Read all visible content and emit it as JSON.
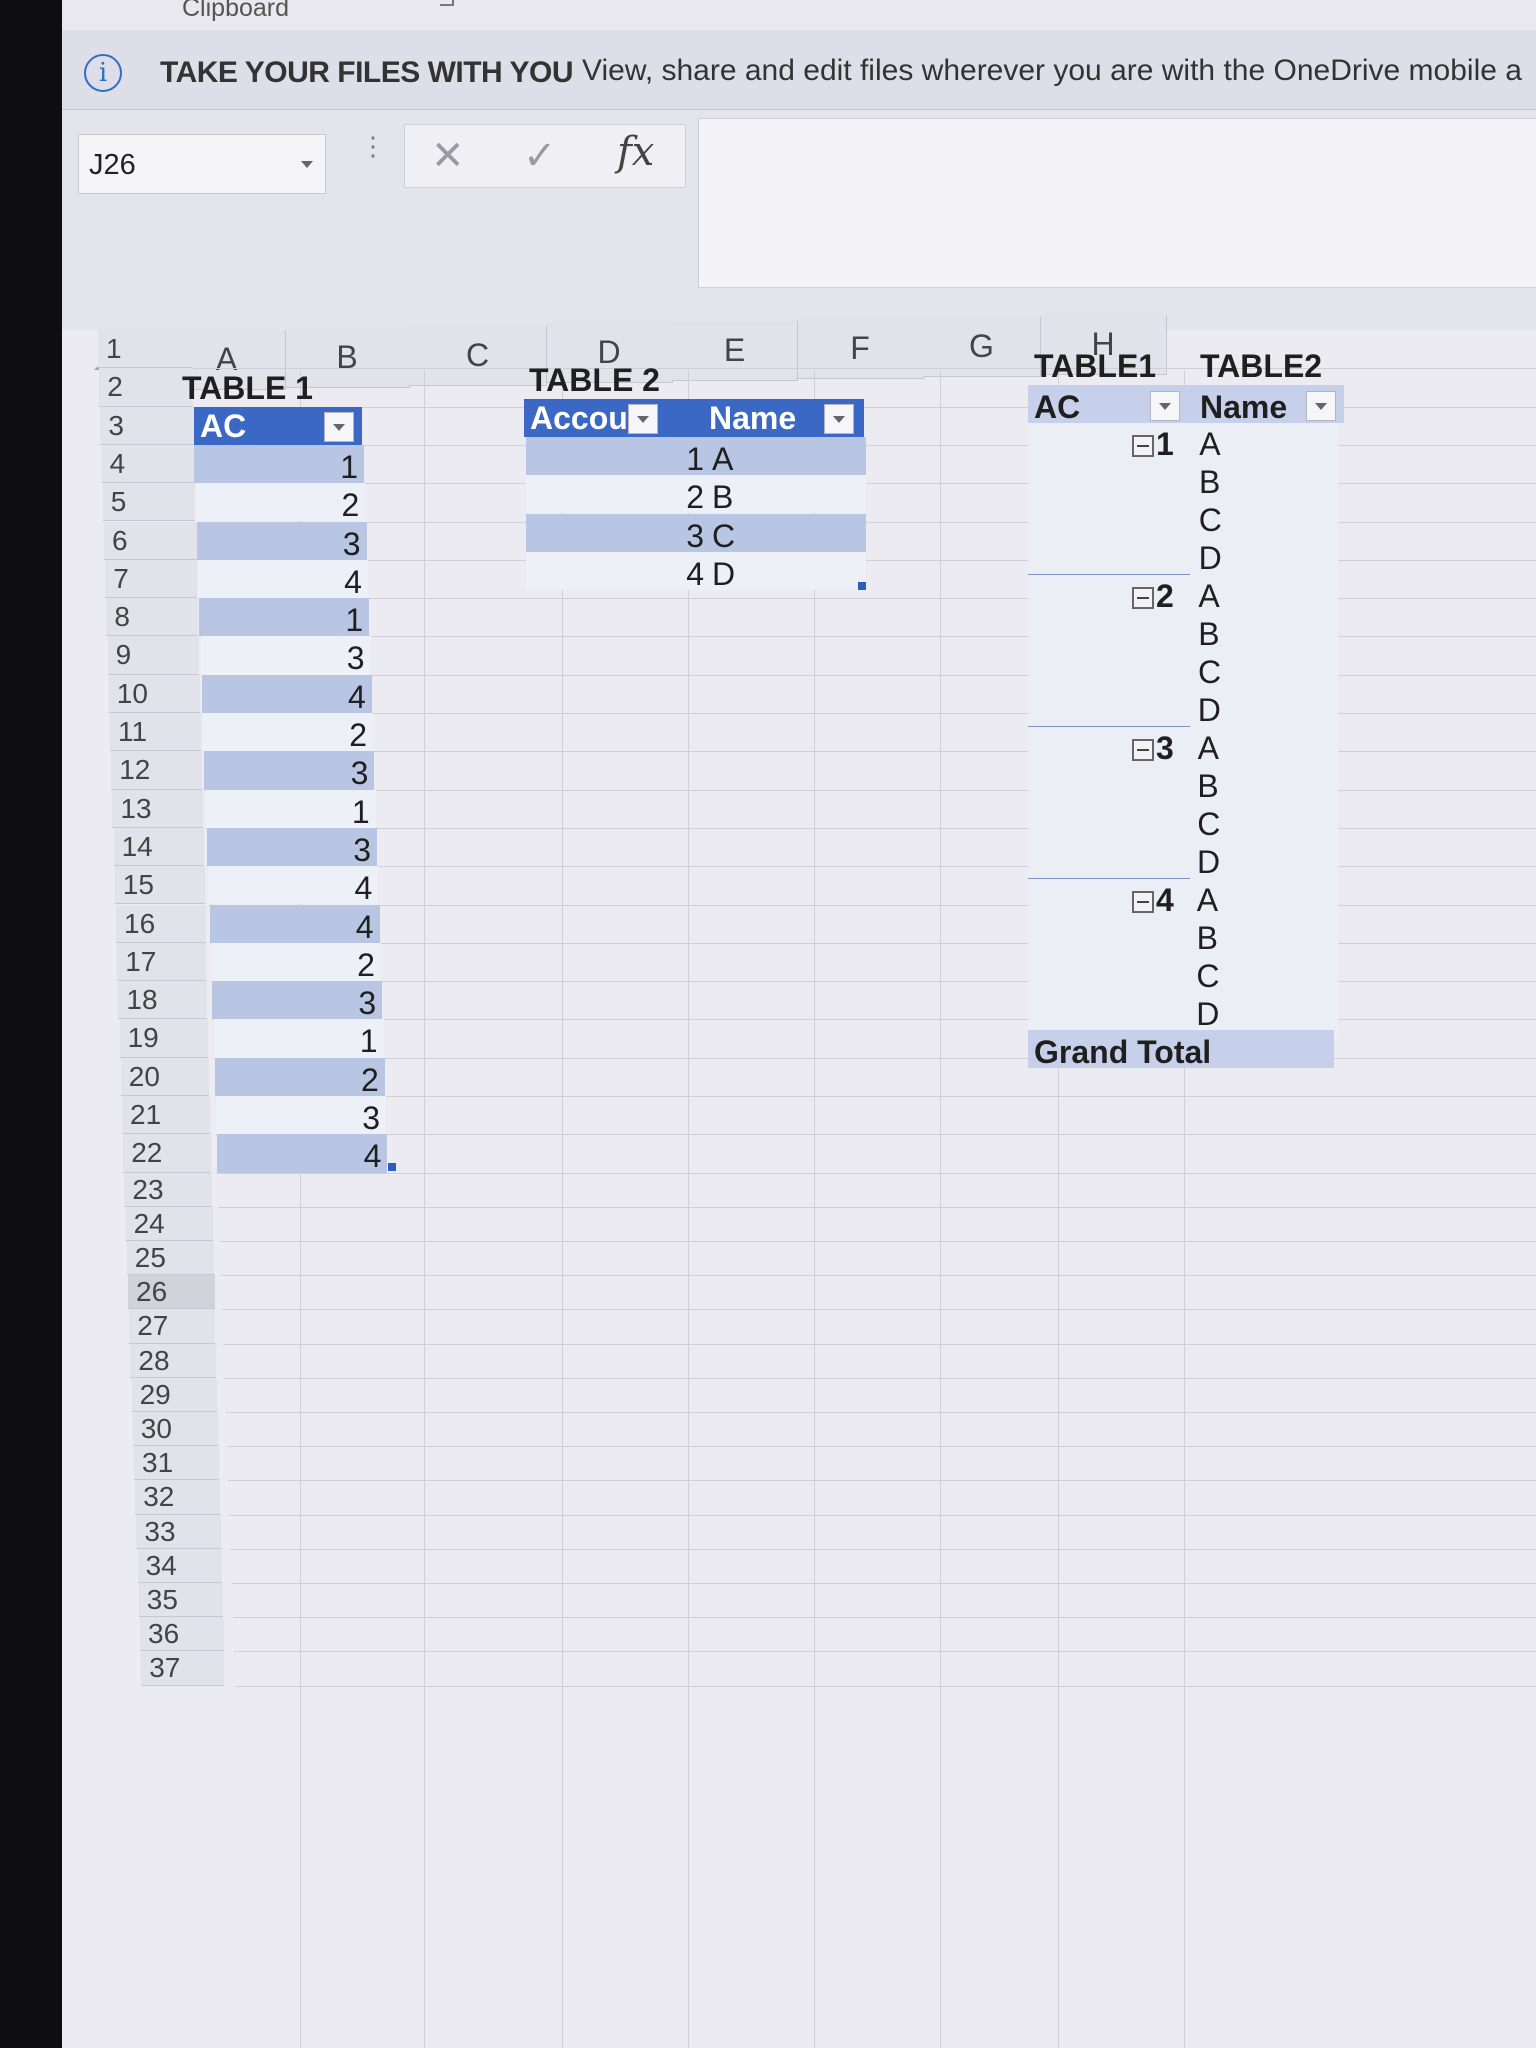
{
  "ribbon": {
    "group_label": "Clipboard"
  },
  "info_bar": {
    "title": "TAKE YOUR FILES WITH YOU",
    "message": "View, share and edit files wherever you are with the OneDrive mobile a"
  },
  "formula_bar": {
    "name_box": "J26",
    "cancel_glyph": "✕",
    "enter_glyph": "✓",
    "fx_label": "fx",
    "formula": ""
  },
  "columns": [
    "A",
    "B",
    "C",
    "D",
    "E",
    "F",
    "G",
    "H"
  ],
  "rows": [
    "1",
    "2",
    "3",
    "4",
    "5",
    "6",
    "7",
    "8",
    "9",
    "10",
    "11",
    "12",
    "13",
    "14",
    "15",
    "16",
    "17",
    "18",
    "19",
    "20",
    "21",
    "22",
    "23",
    "24",
    "25",
    "26",
    "27",
    "28",
    "29",
    "30",
    "31",
    "32",
    "33",
    "34",
    "35",
    "36",
    "37"
  ],
  "active_row": "26",
  "table1": {
    "title": "TABLE 1",
    "header": "AC",
    "values": [
      "1",
      "2",
      "3",
      "4",
      "1",
      "3",
      "4",
      "2",
      "3",
      "1",
      "3",
      "4",
      "4",
      "2",
      "3",
      "1",
      "2",
      "3",
      "4"
    ]
  },
  "table2": {
    "title": "TABLE 2",
    "headers": [
      "Account",
      "Name"
    ],
    "rows": [
      {
        "account": "1",
        "name": "A"
      },
      {
        "account": "2",
        "name": "B"
      },
      {
        "account": "3",
        "name": "C"
      },
      {
        "account": "4",
        "name": "D"
      }
    ]
  },
  "pivot": {
    "title_f": "TABLE1",
    "title_g": "TABLE2",
    "header_f": "AC",
    "header_g": "Name",
    "groups": [
      {
        "key": "1",
        "names": [
          "A",
          "B",
          "C",
          "D"
        ]
      },
      {
        "key": "2",
        "names": [
          "A",
          "B",
          "C",
          "D"
        ]
      },
      {
        "key": "3",
        "names": [
          "A",
          "B",
          "C",
          "D"
        ]
      },
      {
        "key": "4",
        "names": [
          "A",
          "B",
          "C",
          "D"
        ]
      }
    ],
    "grand_total": "Grand Total"
  },
  "colors": {
    "table_header": "#3b68c4",
    "band": "#b8c6e4",
    "pivot_header": "#c6d0ea"
  }
}
